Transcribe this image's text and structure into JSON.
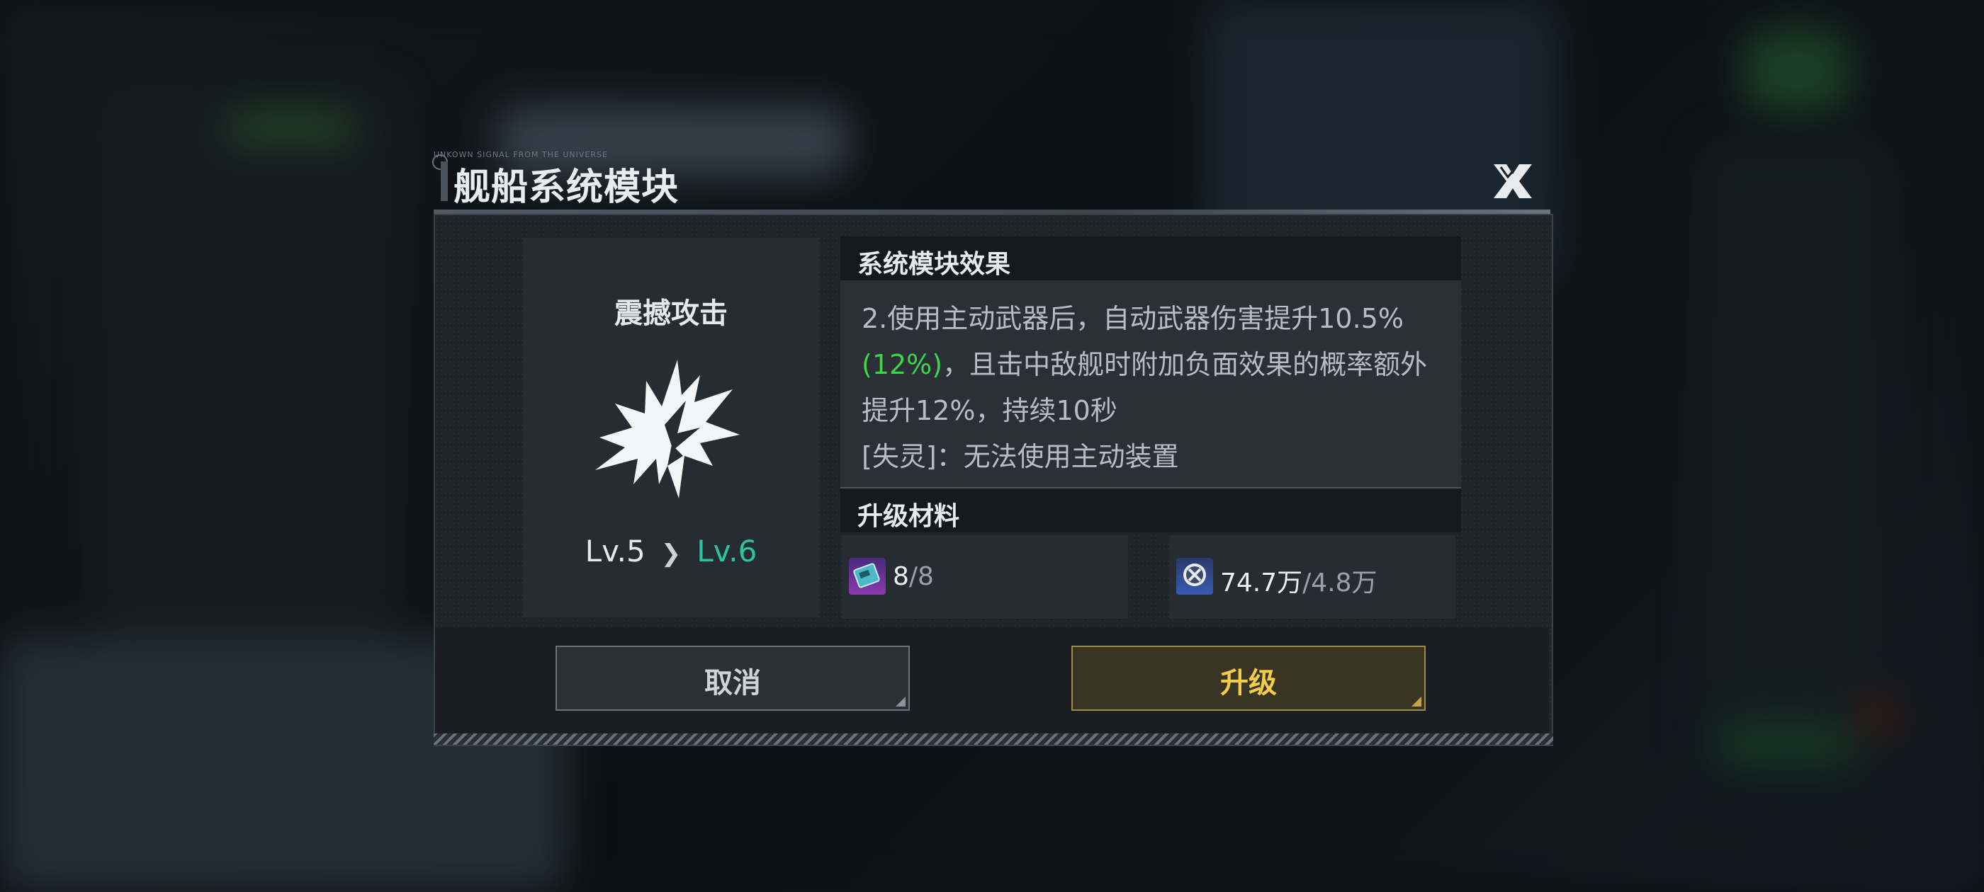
{
  "dialog": {
    "tag_text": "UNKOWN SIGNAL FROM THE UNIVERSE",
    "title": "舰船系统模块"
  },
  "module": {
    "name": "震撼攻击",
    "icon": "burst-icon",
    "level_current": "Lv.5",
    "level_next": "Lv.6"
  },
  "effect": {
    "header": "系统模块效果",
    "text_part1": "2.使用主动武器后，自动武器伤害提升10.5%",
    "text_highlight": "(12%)",
    "text_part2": "，且击中敌舰时附加负面效果的概率额外提升12%，持续10秒",
    "text_line2": "[失灵]：无法使用主动装置"
  },
  "materials": {
    "header": "升级材料",
    "items": [
      {
        "icon": "chip-card-icon",
        "have": "8",
        "need": "/8"
      },
      {
        "icon": "coin-icon",
        "have": "74.7万",
        "need": "/4.8万"
      }
    ]
  },
  "buttons": {
    "cancel": "取消",
    "upgrade": "升级"
  },
  "colors": {
    "accent_green": "#3fd44a",
    "level_teal": "#2cc3a0",
    "upgrade_gold": "#f2cc4a"
  }
}
